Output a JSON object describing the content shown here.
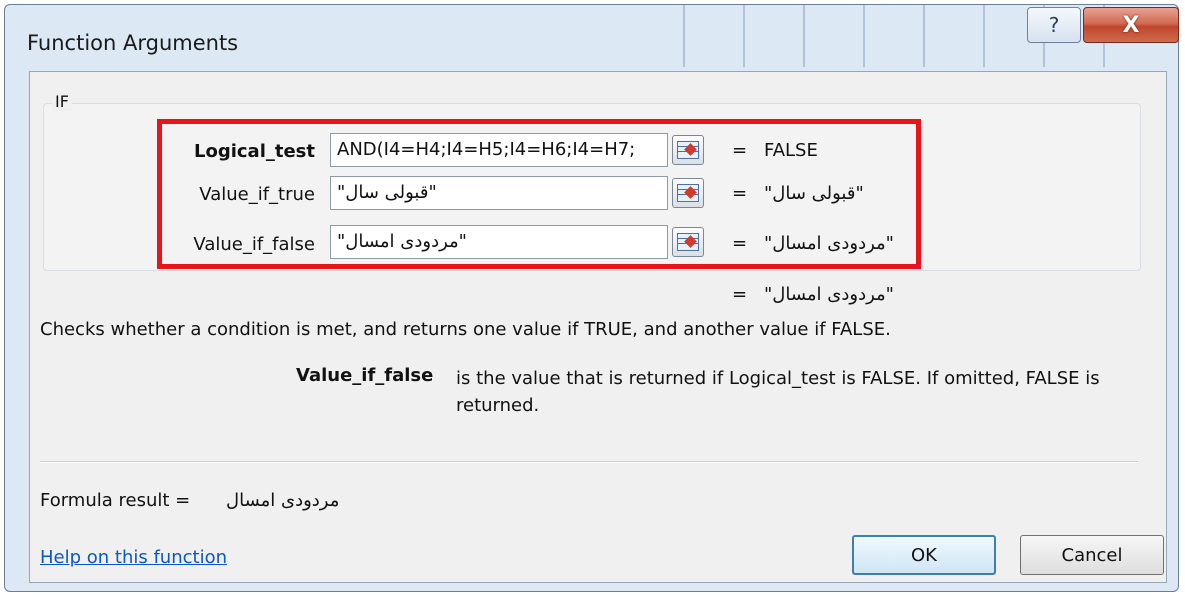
{
  "window": {
    "title": "Function Arguments",
    "help_glyph": "?",
    "close_glyph": "X"
  },
  "group": {
    "title": "IF",
    "rows": [
      {
        "label": "Logical_test",
        "value": "AND(I4=H4;I4=H5;I4=H6;I4=H7;",
        "equals": "=",
        "result": "FALSE"
      },
      {
        "label": "Value_if_true",
        "value": "\"قبولی سال\"",
        "equals": "=",
        "result": "\"قبولی سال\""
      },
      {
        "label": "Value_if_false",
        "value": "\"مردودی امسال\"",
        "equals": "=",
        "result": "\"مردودی امسال\""
      }
    ]
  },
  "function_result": {
    "equals": "=",
    "value": "\"مردودی امسال\""
  },
  "description": "Checks whether a condition is met, and returns one value if TRUE, and another value if FALSE.",
  "argument_help": {
    "name": "Value_if_false",
    "text": "is the value that is returned if Logical_test is FALSE. If omitted, FALSE is returned."
  },
  "formula_result": {
    "label": "Formula result =",
    "value": "مردودی امسال"
  },
  "help_link": "Help on this function",
  "buttons": {
    "ok": "OK",
    "cancel": "Cancel"
  },
  "colors": {
    "highlight": "#e8141b",
    "link": "#0a58c4",
    "close": "#c0462c"
  },
  "icons": {
    "ref": "collapse-dialog-icon",
    "help": "help-icon",
    "close": "close-icon"
  }
}
